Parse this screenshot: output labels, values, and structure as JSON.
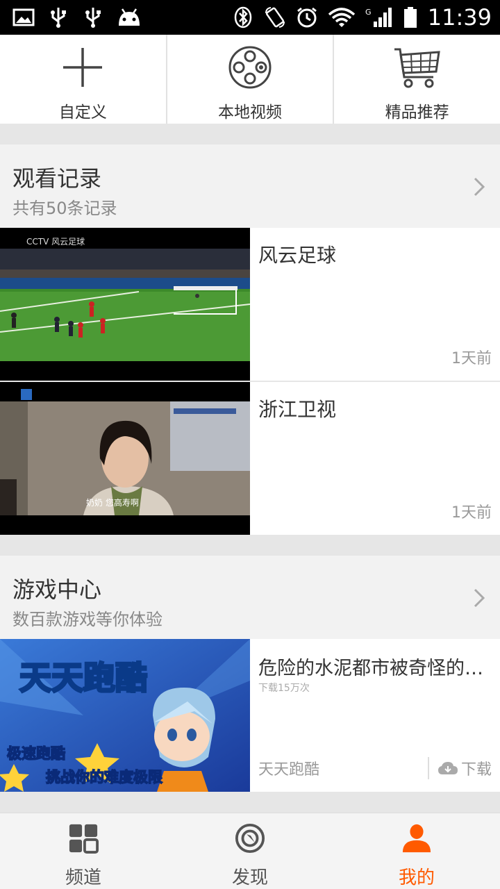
{
  "status_bar": {
    "time": "11:39",
    "icons": [
      "gallery-icon",
      "usb-icon",
      "usb-icon",
      "android-icon",
      "bluetooth-icon",
      "rotate-icon",
      "alarm-icon",
      "wifi-icon",
      "signal-icon",
      "battery-icon"
    ]
  },
  "quick_actions": [
    {
      "label": "自定义",
      "icon": "plus-icon"
    },
    {
      "label": "本地视频",
      "icon": "film-reel-icon"
    },
    {
      "label": "精品推荐",
      "icon": "cart-icon"
    }
  ],
  "history": {
    "title": "观看记录",
    "subtitle": "共有50条记录",
    "items": [
      {
        "title": "风云足球",
        "time": "1天前",
        "thumb_caption": "CCTV 风云足球"
      },
      {
        "title": "浙江卫视",
        "time": "1天前",
        "thumb_caption": "奶奶 您高寿啊"
      }
    ]
  },
  "games": {
    "title": "游戏中心",
    "subtitle": "数百款游戏等你体验",
    "item": {
      "desc": "危险的水泥都市被奇怪的…",
      "downloads": "下载15万次",
      "name": "天天跑酷",
      "download_label": "下载",
      "banner_title": "天天跑酷",
      "banner_line1": "极速跑酷",
      "banner_line2": "挑战你的难度极限"
    }
  },
  "bottom_nav": [
    {
      "label": "频道",
      "icon": "grid-icon",
      "active": false
    },
    {
      "label": "发现",
      "icon": "compass-icon",
      "active": false
    },
    {
      "label": "我的",
      "icon": "user-icon",
      "active": true
    }
  ],
  "colors": {
    "accent": "#ff5a00",
    "text": "#333333",
    "muted": "#999999",
    "bg": "#e6e6e6"
  }
}
